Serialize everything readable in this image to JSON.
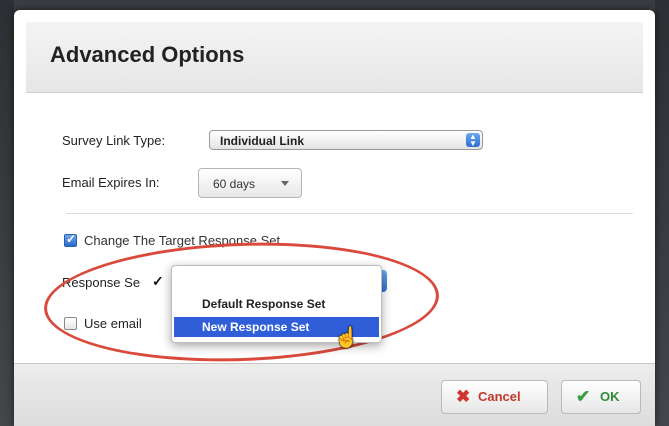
{
  "dialog": {
    "title": "Advanced Options"
  },
  "form": {
    "survey_link_type_label": "Survey Link Type:",
    "survey_link_type_value": "Individual Link",
    "email_expires_label": "Email Expires In:",
    "email_expires_value": "60 days",
    "change_target_label": "Change The Target Response Set",
    "response_set_label": "Response Se",
    "use_email_label": "Use email"
  },
  "dropdown": {
    "items": [
      {
        "label": "",
        "checked": true
      },
      {
        "label": "Default Response Set",
        "checked": false
      },
      {
        "label": "New Response Set",
        "checked": false,
        "highlighted": true
      }
    ]
  },
  "footer": {
    "cancel_label": "Cancel",
    "ok_label": "OK"
  },
  "colors": {
    "accent": "#2f5ed8",
    "annotation": "#d94a3d",
    "cancel": "#c0392b",
    "ok": "#2e8b3a"
  }
}
